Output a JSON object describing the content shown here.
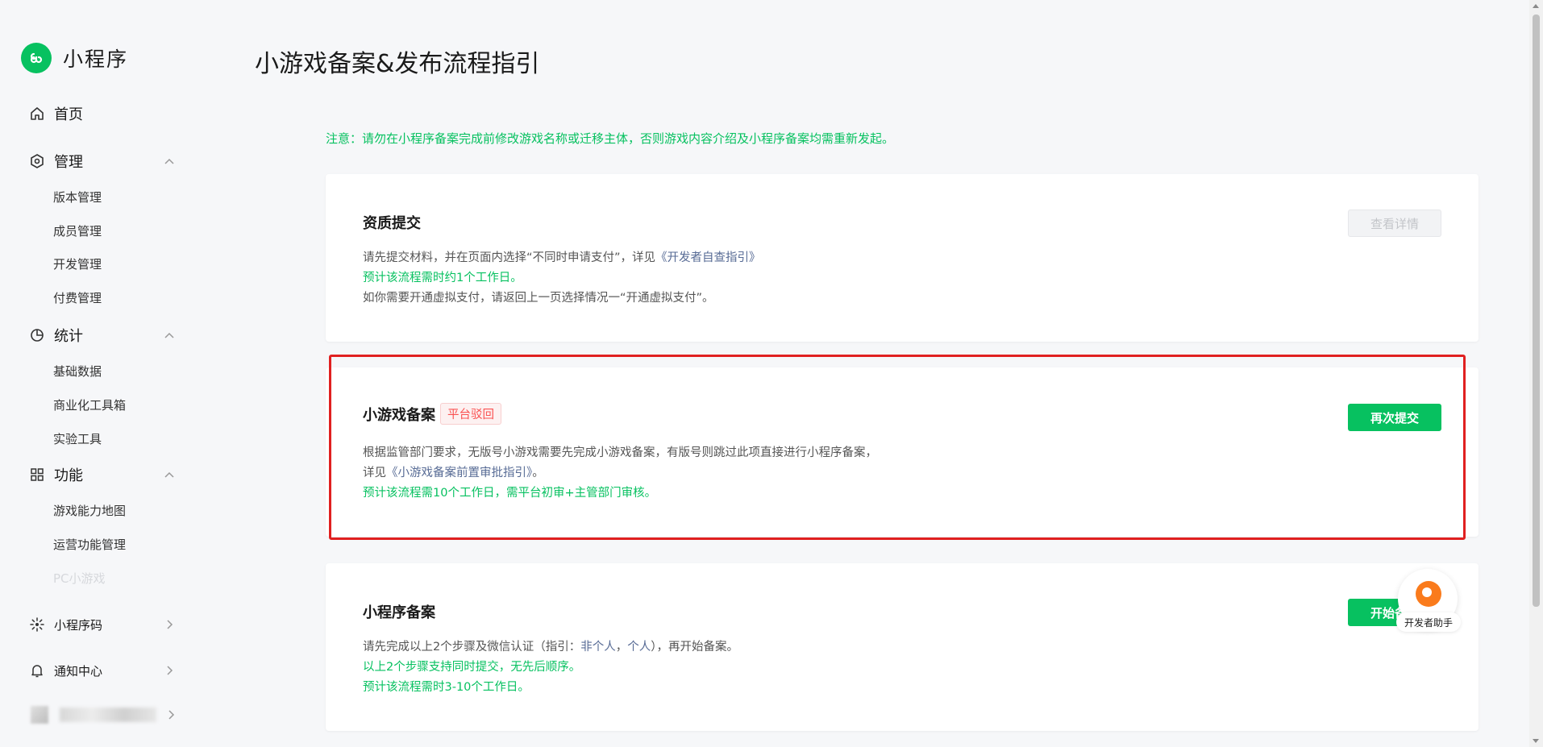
{
  "sidebar": {
    "app_name": "小程序",
    "home": "首页",
    "manage": {
      "label": "管理",
      "items": [
        "版本管理",
        "成员管理",
        "开发管理",
        "付费管理"
      ]
    },
    "stats": {
      "label": "统计",
      "items": [
        "基础数据",
        "商业化工具箱",
        "实验工具"
      ]
    },
    "features": {
      "label": "功能",
      "items": [
        "游戏能力地图",
        "运营功能管理",
        "PC小游戏"
      ]
    },
    "qrcode": "小程序码",
    "notifications": "通知中心"
  },
  "main": {
    "title": "小游戏备案&发布流程指引",
    "notice": "注意：请勿在小程序备案完成前修改游戏名称或迁移主体，否则游戏内容介绍及小程序备案均需重新发起。",
    "cards": [
      {
        "title": "资质提交",
        "button": "查看详情",
        "line1_prefix": "请先提交材料，并在页面内选择“不同时申请支付”，详见",
        "line1_link": "《开发者自查指引》",
        "line2": "预计该流程需时约1个工作日。",
        "line3": "如你需要开通虚拟支付，请返回上一页选择情况一“开通虚拟支付”。"
      },
      {
        "title": "小游戏备案",
        "badge": "平台驳回",
        "button": "再次提交",
        "line1": "根据监管部门要求，无版号小游戏需要先完成小游戏备案，有版号则跳过此项直接进行小程序备案，",
        "line2_prefix": "详见",
        "line2_link": "《小游戏备案前置审批指引》",
        "line2_suffix": "。",
        "line3": "预计该流程需10个工作日，需平台初审+主管部门审核。"
      },
      {
        "title": "小程序备案",
        "button": "开始备案",
        "line1_prefix": "请先完成以上2个步骤及微信认证（指引：",
        "line1_link1": "非个人",
        "line1_sep": "，",
        "line1_link2": "个人",
        "line1_suffix": "），再开始备案。",
        "line2": "以上2个步骤支持同时提交，无先后顺序。",
        "line3": "预计该流程需时3-10个工作日。"
      }
    ]
  },
  "assistant": {
    "label": "开发者助手"
  },
  "colors": {
    "brand_green": "#07c160",
    "link_blue": "#576b95",
    "reject_red": "#fa5151",
    "highlight_red": "#e02020"
  }
}
